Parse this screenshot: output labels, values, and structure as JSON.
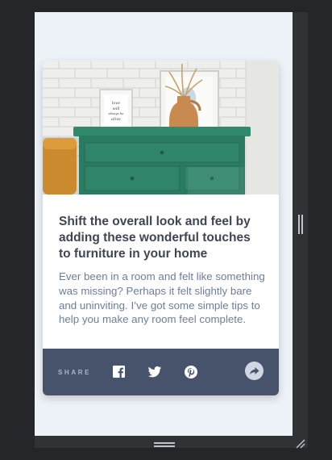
{
  "card": {
    "title": "Shift the overall look and feel by adding these wonderful touches to furniture in your home",
    "description": "Ever been in a room and felt like something was missing? Perhaps it felt slightly bare and uninviting. I’ve got some simple tips to help you make any room feel complete.",
    "share_label": "SHARE",
    "frame_text": "love will always be alive"
  },
  "share_icons": [
    "facebook-icon",
    "twitter-icon",
    "pinterest-icon",
    "share-arrow-icon"
  ],
  "colors": {
    "page_bg": "#ecf2f8",
    "share_bar": "#47536b",
    "title": "#3f4555",
    "description": "#6d7d99",
    "dresser": "#2b7a62"
  }
}
